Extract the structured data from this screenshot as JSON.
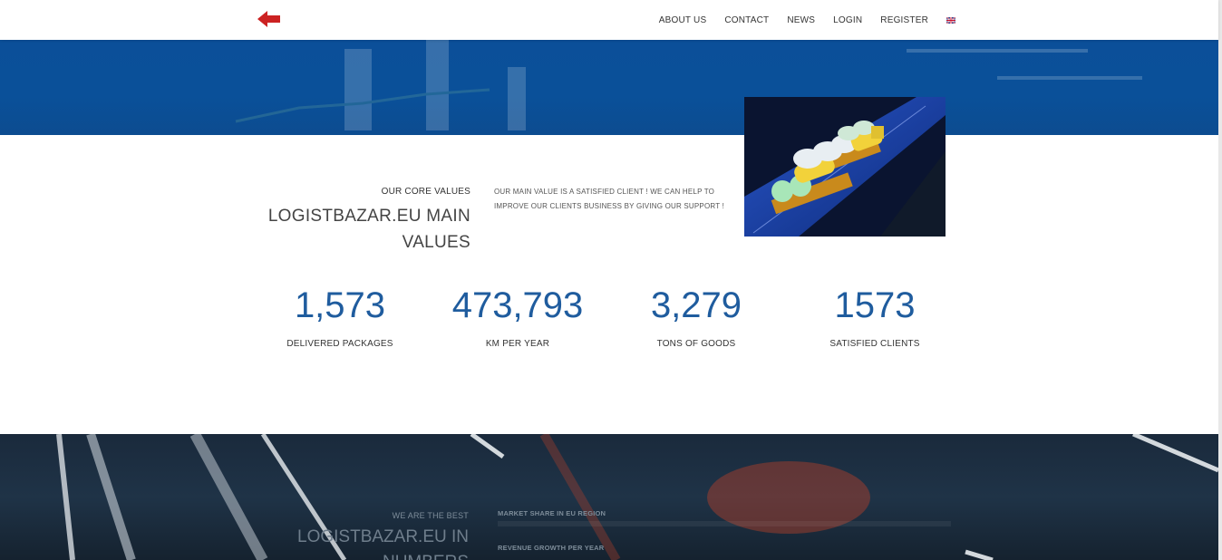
{
  "nav": {
    "items": [
      "ABOUT US",
      "CONTACT",
      "NEWS",
      "LOGIN",
      "REGISTER"
    ],
    "language_icon": "uk-flag-icon",
    "back_icon": "red-left-arrow-icon"
  },
  "core_values": {
    "eyebrow": "OUR CORE VALUES",
    "title": "LOGISTBAZAR.EU MAIN VALUES",
    "description": "OUR MAIN VALUE IS A SATISFIED CLIENT ! WE CAN HELP TO IMPROVE OUR CLIENTS BUSINESS BY GIVING OUR SUPPORT !"
  },
  "stats": [
    {
      "value": "1,573",
      "label": "DELIVERED PACKAGES"
    },
    {
      "value": "473,793",
      "label": "KM PER YEAR"
    },
    {
      "value": "3,279",
      "label": "TONS OF GOODS"
    },
    {
      "value": "1573",
      "label": "SATISFIED CLIENTS"
    }
  ],
  "numbers_section": {
    "eyebrow": "WE ARE THE BEST",
    "title": "LOGISTBAZAR.EU IN NUMBERS",
    "metrics": [
      "MARKET SHARE IN EU REGION",
      "REVENUE GROWTH PER YEAR"
    ]
  },
  "colors": {
    "accent_blue": "#1f5c9e",
    "band_blue": "#0b4f99",
    "dark_section": "#1a2a3c",
    "arrow_red": "#cc2222"
  }
}
